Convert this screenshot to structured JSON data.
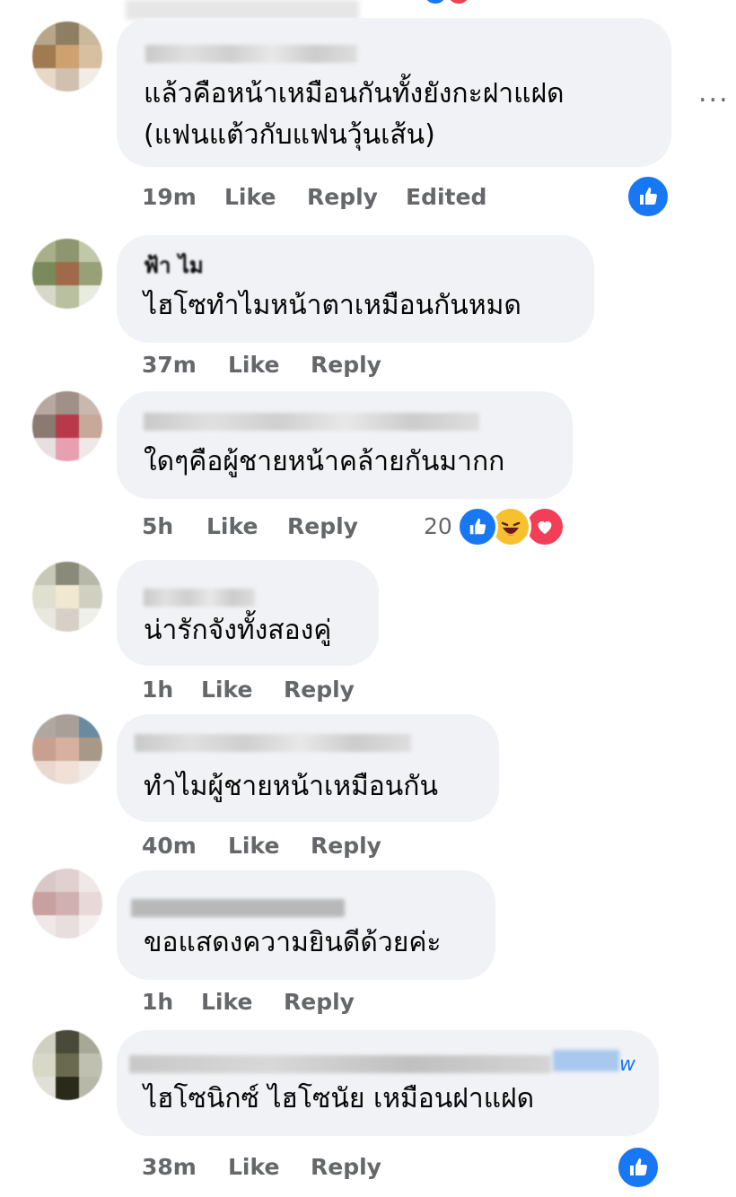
{
  "comments": [
    {
      "text_lines": [
        "แล้วคือหน้าเหมือนกันทั้งยังกะฝาแฝด",
        "(แฟนแต้วกับแฟนวุ้นเส้น)"
      ],
      "time": "19m",
      "like": "Like",
      "reply": "Reply",
      "edited": "Edited"
    },
    {
      "name_partial": "ฟ้า ไม",
      "text_lines": [
        "ไฮโซทำไมหน้าตาเหมือนกันหมด"
      ],
      "time": "37m",
      "like": "Like",
      "reply": "Reply"
    },
    {
      "text_lines": [
        "ใดๆคือผู้ชายหน้าคล้ายกันมากก"
      ],
      "time": "5h",
      "like": "Like",
      "reply": "Reply",
      "reaction_count": "20"
    },
    {
      "text_lines": [
        "น่ารักจังทั้งสองคู่"
      ],
      "time": "1h",
      "like": "Like",
      "reply": "Reply"
    },
    {
      "text_lines": [
        "ทำไมผู้ชายหน้าเหมือนกัน"
      ],
      "time": "40m",
      "like": "Like",
      "reply": "Reply"
    },
    {
      "text_lines": [
        "ขอแสดงความยินดีด้วยค่ะ"
      ],
      "time": "1h",
      "like": "Like",
      "reply": "Reply"
    },
    {
      "name_suffix": "w",
      "text_lines": [
        "ไฮโซนิกซ์ ไฮโซนัย เหมือนฝาแฝด"
      ],
      "time": "38m",
      "like": "Like",
      "reply": "Reply"
    }
  ],
  "more_options": "...",
  "colors": {
    "bubble": "#f0f2f5",
    "meta": "#65676b",
    "like_blue": "#1877f2",
    "text": "#050505"
  },
  "icons": {
    "like": "thumbs-up-icon",
    "haha": "haha-emoji-icon",
    "love": "heart-icon"
  }
}
